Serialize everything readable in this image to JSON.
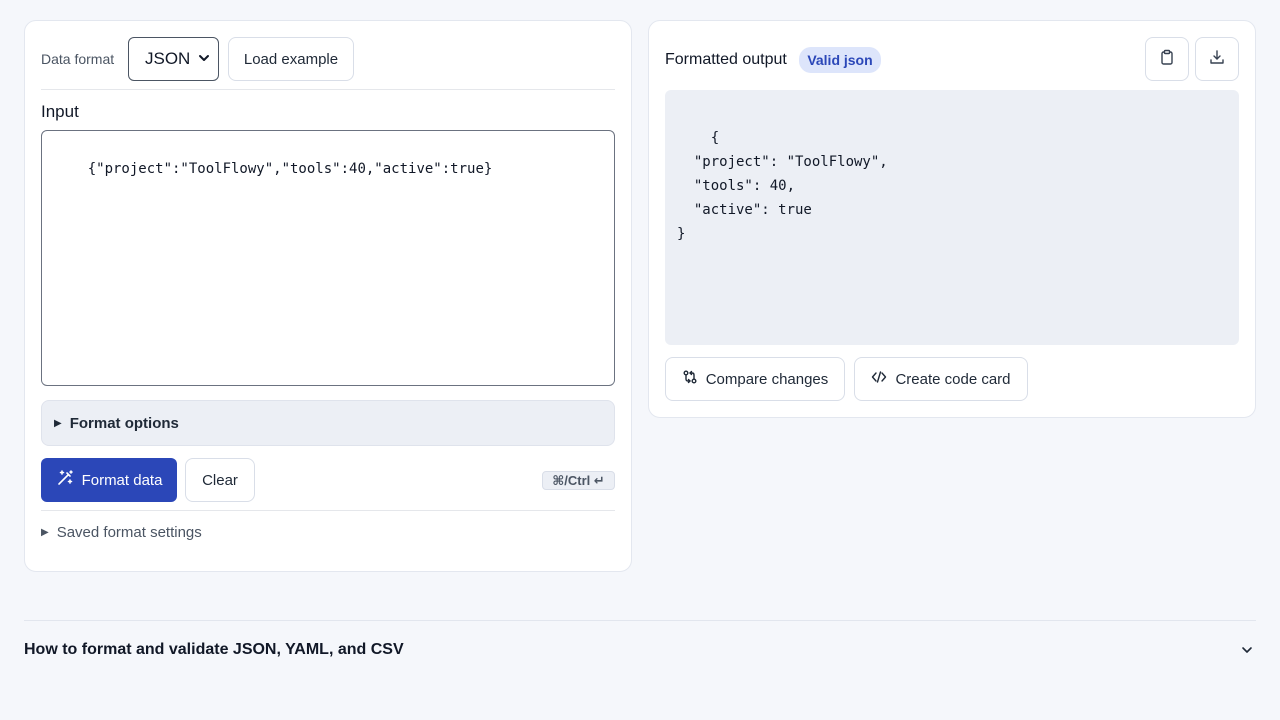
{
  "input_panel": {
    "format_label": "Data format",
    "format_select": {
      "selected": "JSON"
    },
    "load_example_label": "Load example",
    "input_heading": "Input",
    "input_value": "{\"project\":\"ToolFlowy\",\"tools\":40,\"active\":true}",
    "format_options_label": "Format options",
    "format_button_label": "Format data",
    "clear_button_label": "Clear",
    "shortcut_label": "⌘/Ctrl ↵",
    "saved_settings_label": "Saved format settings"
  },
  "output_panel": {
    "title": "Formatted output",
    "status_badge": "Valid json",
    "output_text": "{\n  \"project\": \"ToolFlowy\",\n  \"tools\": 40,\n  \"active\": true\n}",
    "compare_button_label": "Compare changes",
    "code_card_button_label": "Create code card",
    "icons": {
      "copy": "clipboard-icon",
      "download": "download-icon"
    }
  },
  "faq": {
    "title": "How to format and validate JSON, YAML, and CSV"
  },
  "colors": {
    "primary": "#2b47b8",
    "badge_bg": "#dde5fb",
    "page_bg": "#f5f7fb"
  }
}
